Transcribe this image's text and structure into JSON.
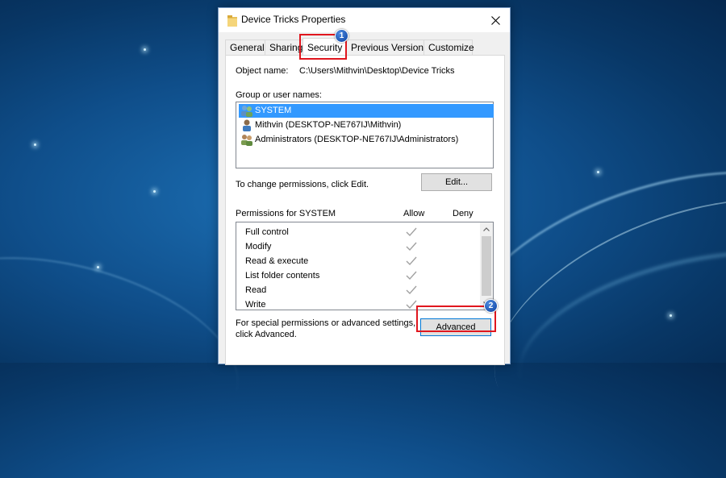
{
  "window": {
    "title": "Device Tricks Properties",
    "close_glyph": "✕"
  },
  "tabs": [
    {
      "label": "General",
      "active": false
    },
    {
      "label": "Sharing",
      "active": false
    },
    {
      "label": "Security",
      "active": true
    },
    {
      "label": "Previous Versions",
      "active": false
    },
    {
      "label": "Customize",
      "active": false
    }
  ],
  "object": {
    "label": "Object name:",
    "value": "C:\\Users\\Mithvin\\Desktop\\Device Tricks"
  },
  "groups": {
    "label": "Group or user names:",
    "items": [
      {
        "name": "SYSTEM",
        "selected": true,
        "icon": "user-group-icon"
      },
      {
        "name": "Mithvin (DESKTOP-NE767IJ\\Mithvin)",
        "selected": false,
        "icon": "user-icon"
      },
      {
        "name": "Administrators (DESKTOP-NE767IJ\\Administrators)",
        "selected": false,
        "icon": "user-group-icon"
      }
    ]
  },
  "change_perm": {
    "text": "To change permissions, click Edit.",
    "edit_label": "Edit..."
  },
  "permissions": {
    "label": "Permissions for SYSTEM",
    "allow_header": "Allow",
    "deny_header": "Deny",
    "rows": [
      {
        "name": "Full control",
        "allow": true,
        "deny": false
      },
      {
        "name": "Modify",
        "allow": true,
        "deny": false
      },
      {
        "name": "Read & execute",
        "allow": true,
        "deny": false
      },
      {
        "name": "List folder contents",
        "allow": true,
        "deny": false
      },
      {
        "name": "Read",
        "allow": true,
        "deny": false
      },
      {
        "name": "Write",
        "allow": true,
        "deny": false
      }
    ]
  },
  "advanced": {
    "line1": "For special permissions or advanced settings,",
    "line2": "click Advanced.",
    "button_label": "Advanced"
  },
  "annotations": [
    {
      "number": "1",
      "color": "#e0161e"
    },
    {
      "number": "2",
      "color": "#e0161e"
    }
  ],
  "colors": {
    "selection": "#3399ff",
    "highlight": "#e0161e",
    "check": "#a0a0a0"
  }
}
